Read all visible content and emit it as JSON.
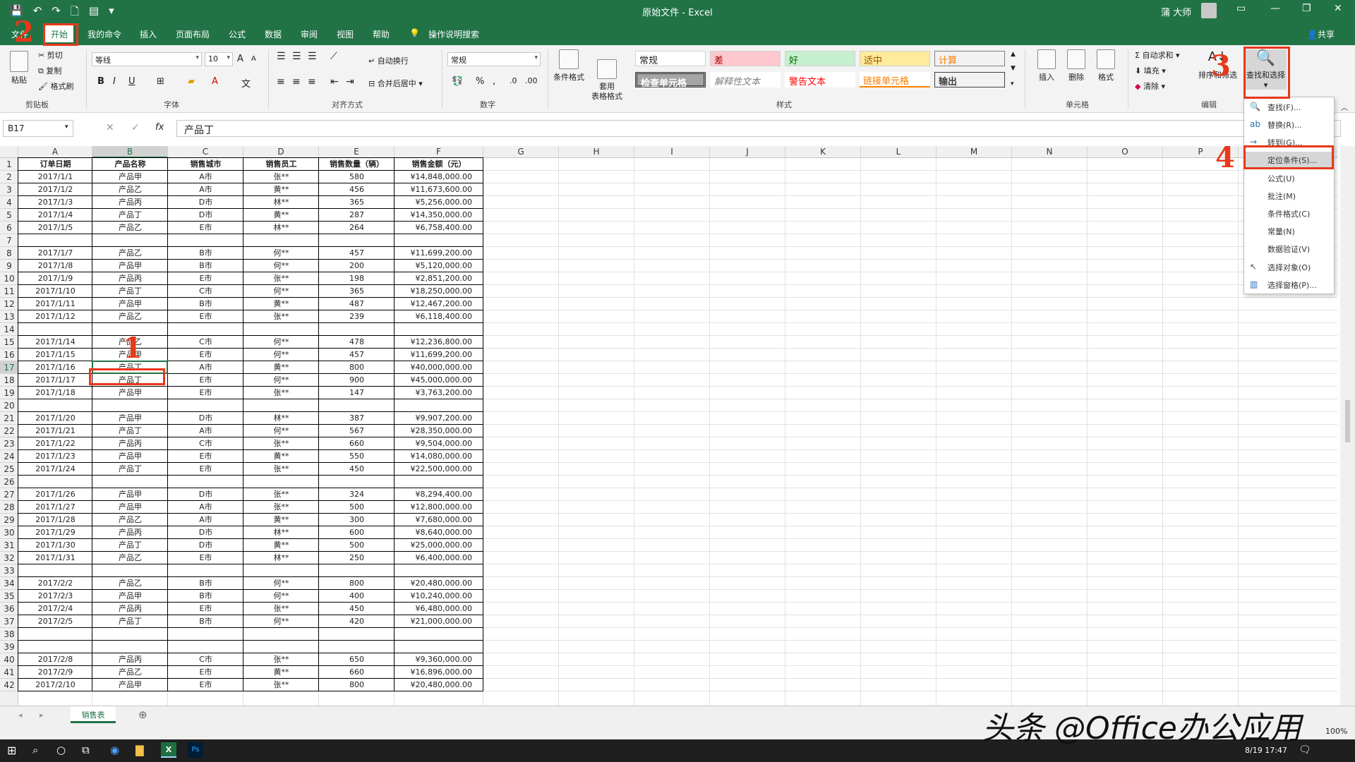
{
  "titlebar": {
    "title": "原始文件 - Excel",
    "user": "蒲 大师"
  },
  "menu": {
    "tabs": [
      "文件",
      "开始",
      "我的命令",
      "插入",
      "页面布局",
      "公式",
      "数据",
      "审阅",
      "视图",
      "帮助"
    ],
    "tell_me": "操作说明搜索",
    "share": "共享"
  },
  "ribbon": {
    "clipboard": {
      "paste": "粘贴",
      "cut": "剪切",
      "copy": "复制",
      "format_painter": "格式刷",
      "label": "剪贴板"
    },
    "font": {
      "name": "等线",
      "size": "10",
      "label": "字体",
      "bold": "B",
      "italic": "I",
      "underline": "U",
      "inc": "A",
      "dec": "A"
    },
    "alignment": {
      "wrap": "自动换行",
      "merge": "合并后居中",
      "label": "对齐方式"
    },
    "number": {
      "format": "常规",
      "label": "数字",
      "percent": "%"
    },
    "styles": {
      "cond_format": "条件格式",
      "table_format": "套用\n表格格式",
      "label": "样式",
      "cells": [
        "常规",
        "差",
        "好",
        "适中",
        "计算",
        "检查单元格",
        "解释性文本",
        "警告文本",
        "链接单元格",
        "输出"
      ],
      "colors": {
        "normal": "#ffffff",
        "bad": "#ffc7ce",
        "good": "#c6efce",
        "neutral": "#ffeb9c",
        "calc": "#f2f2f2",
        "check": "#a5a5a5"
      }
    },
    "cells_group": {
      "insert": "插入",
      "delete": "删除",
      "format": "格式",
      "label": "单元格"
    },
    "editing": {
      "autosum": "自动求和",
      "fill": "填充",
      "clear": "清除",
      "sort": "排序和筛选",
      "find": "查找和选择",
      "label": "编辑"
    }
  },
  "formula_bar": {
    "name_box": "B17",
    "content": "产品丁"
  },
  "grid": {
    "columns": [
      "A",
      "B",
      "C",
      "D",
      "E",
      "F",
      "G",
      "H",
      "I",
      "J",
      "K",
      "L",
      "M",
      "N",
      "O",
      "P"
    ],
    "headers": [
      "订单日期",
      "产品名称",
      "销售城市",
      "销售员工",
      "销售数量（辆）",
      "销售金额（元）"
    ],
    "rows": [
      [
        "2017/1/1",
        "产品甲",
        "A市",
        "张**",
        "580",
        "¥14,848,000.00"
      ],
      [
        "2017/1/2",
        "产品乙",
        "A市",
        "黄**",
        "456",
        "¥11,673,600.00"
      ],
      [
        "2017/1/3",
        "产品丙",
        "D市",
        "林**",
        "365",
        "¥5,256,000.00"
      ],
      [
        "2017/1/4",
        "产品丁",
        "D市",
        "黄**",
        "287",
        "¥14,350,000.00"
      ],
      [
        "2017/1/5",
        "产品乙",
        "E市",
        "林**",
        "264",
        "¥6,758,400.00"
      ],
      [
        "",
        "",
        "",
        "",
        "",
        ""
      ],
      [
        "2017/1/7",
        "产品乙",
        "B市",
        "何**",
        "457",
        "¥11,699,200.00"
      ],
      [
        "2017/1/8",
        "产品甲",
        "B市",
        "何**",
        "200",
        "¥5,120,000.00"
      ],
      [
        "2017/1/9",
        "产品丙",
        "E市",
        "张**",
        "198",
        "¥2,851,200.00"
      ],
      [
        "2017/1/10",
        "产品丁",
        "C市",
        "何**",
        "365",
        "¥18,250,000.00"
      ],
      [
        "2017/1/11",
        "产品甲",
        "B市",
        "黄**",
        "487",
        "¥12,467,200.00"
      ],
      [
        "2017/1/12",
        "产品乙",
        "E市",
        "张**",
        "239",
        "¥6,118,400.00"
      ],
      [
        "",
        "",
        "",
        "",
        "",
        ""
      ],
      [
        "2017/1/14",
        "产品乙",
        "C市",
        "何**",
        "478",
        "¥12,236,800.00"
      ],
      [
        "2017/1/15",
        "产品甲",
        "E市",
        "何**",
        "457",
        "¥11,699,200.00"
      ],
      [
        "2017/1/16",
        "产品丁",
        "A市",
        "黄**",
        "800",
        "¥40,000,000.00"
      ],
      [
        "2017/1/17",
        "产品丁",
        "E市",
        "何**",
        "900",
        "¥45,000,000.00"
      ],
      [
        "2017/1/18",
        "产品甲",
        "E市",
        "张**",
        "147",
        "¥3,763,200.00"
      ],
      [
        "",
        "",
        "",
        "",
        "",
        ""
      ],
      [
        "2017/1/20",
        "产品甲",
        "D市",
        "林**",
        "387",
        "¥9,907,200.00"
      ],
      [
        "2017/1/21",
        "产品丁",
        "A市",
        "何**",
        "567",
        "¥28,350,000.00"
      ],
      [
        "2017/1/22",
        "产品丙",
        "C市",
        "张**",
        "660",
        "¥9,504,000.00"
      ],
      [
        "2017/1/23",
        "产品甲",
        "E市",
        "黄**",
        "550",
        "¥14,080,000.00"
      ],
      [
        "2017/1/24",
        "产品丁",
        "E市",
        "张**",
        "450",
        "¥22,500,000.00"
      ],
      [
        "",
        "",
        "",
        "",
        "",
        ""
      ],
      [
        "2017/1/26",
        "产品甲",
        "D市",
        "张**",
        "324",
        "¥8,294,400.00"
      ],
      [
        "2017/1/27",
        "产品甲",
        "A市",
        "张**",
        "500",
        "¥12,800,000.00"
      ],
      [
        "2017/1/28",
        "产品乙",
        "A市",
        "黄**",
        "300",
        "¥7,680,000.00"
      ],
      [
        "2017/1/29",
        "产品丙",
        "D市",
        "林**",
        "600",
        "¥8,640,000.00"
      ],
      [
        "2017/1/30",
        "产品丁",
        "D市",
        "黄**",
        "500",
        "¥25,000,000.00"
      ],
      [
        "2017/1/31",
        "产品乙",
        "E市",
        "林**",
        "250",
        "¥6,400,000.00"
      ],
      [
        "",
        "",
        "",
        "",
        "",
        ""
      ],
      [
        "2017/2/2",
        "产品乙",
        "B市",
        "何**",
        "800",
        "¥20,480,000.00"
      ],
      [
        "2017/2/3",
        "产品甲",
        "B市",
        "何**",
        "400",
        "¥10,240,000.00"
      ],
      [
        "2017/2/4",
        "产品丙",
        "E市",
        "张**",
        "450",
        "¥6,480,000.00"
      ],
      [
        "2017/2/5",
        "产品丁",
        "B市",
        "何**",
        "420",
        "¥21,000,000.00"
      ],
      [
        "",
        "",
        "",
        "",
        "",
        ""
      ],
      [
        "",
        "",
        "",
        "",
        "",
        ""
      ],
      [
        "2017/2/8",
        "产品丙",
        "C市",
        "张**",
        "650",
        "¥9,360,000.00"
      ],
      [
        "2017/2/9",
        "产品乙",
        "E市",
        "黄**",
        "660",
        "¥16,896,000.00"
      ],
      [
        "2017/2/10",
        "产品甲",
        "E市",
        "张**",
        "800",
        "¥20,480,000.00"
      ]
    ]
  },
  "dropdown": {
    "items": [
      "查找(F)...",
      "替换(R)...",
      "转到(G)...",
      "定位条件(S)...",
      "公式(U)",
      "批注(M)",
      "条件格式(C)",
      "常量(N)",
      "数据验证(V)",
      "选择对象(O)",
      "选择窗格(P)..."
    ]
  },
  "annotations": [
    "1",
    "2",
    "3",
    "4"
  ],
  "sheet_tab": "销售表",
  "status": {
    "zoom": "100%"
  },
  "taskbar": {
    "time": "8/19 17:47"
  },
  "watermark": "头条 @Office办公应用"
}
